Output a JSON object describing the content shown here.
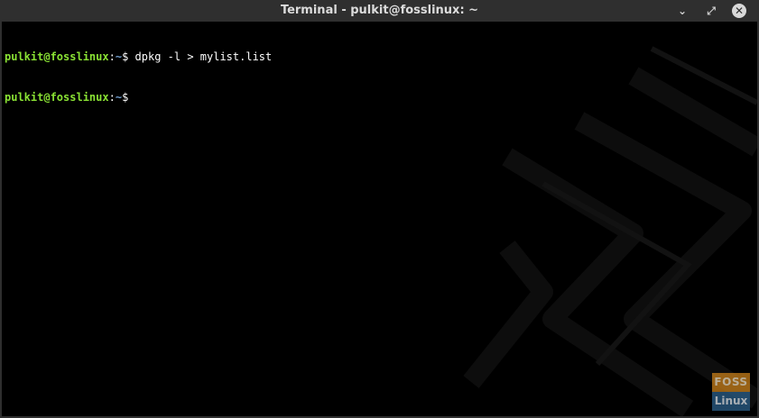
{
  "window": {
    "title": "Terminal - pulkit@fosslinux: ~",
    "controls": {
      "minimize_icon": "⌄",
      "restore_icon": "⤢",
      "close_icon": "✕"
    }
  },
  "terminal": {
    "lines": [
      {
        "user_host": "pulkit@fosslinux",
        "separator": ":",
        "path": "~",
        "dollar": "$",
        "command": " dpkg -l > mylist.list"
      },
      {
        "user_host": "pulkit@fosslinux",
        "separator": ":",
        "path": "~",
        "dollar": "$",
        "command": ""
      }
    ]
  },
  "watermark": {
    "top": "FOSS",
    "bottom": "Linux"
  },
  "colors": {
    "prompt_user": "#8ae234",
    "prompt_path": "#729fcf",
    "titlebar_bg": "#2f2f2f",
    "terminal_bg": "#000000",
    "watermark_top": "#c87f1a",
    "watermark_bottom": "#2b5f8a"
  }
}
